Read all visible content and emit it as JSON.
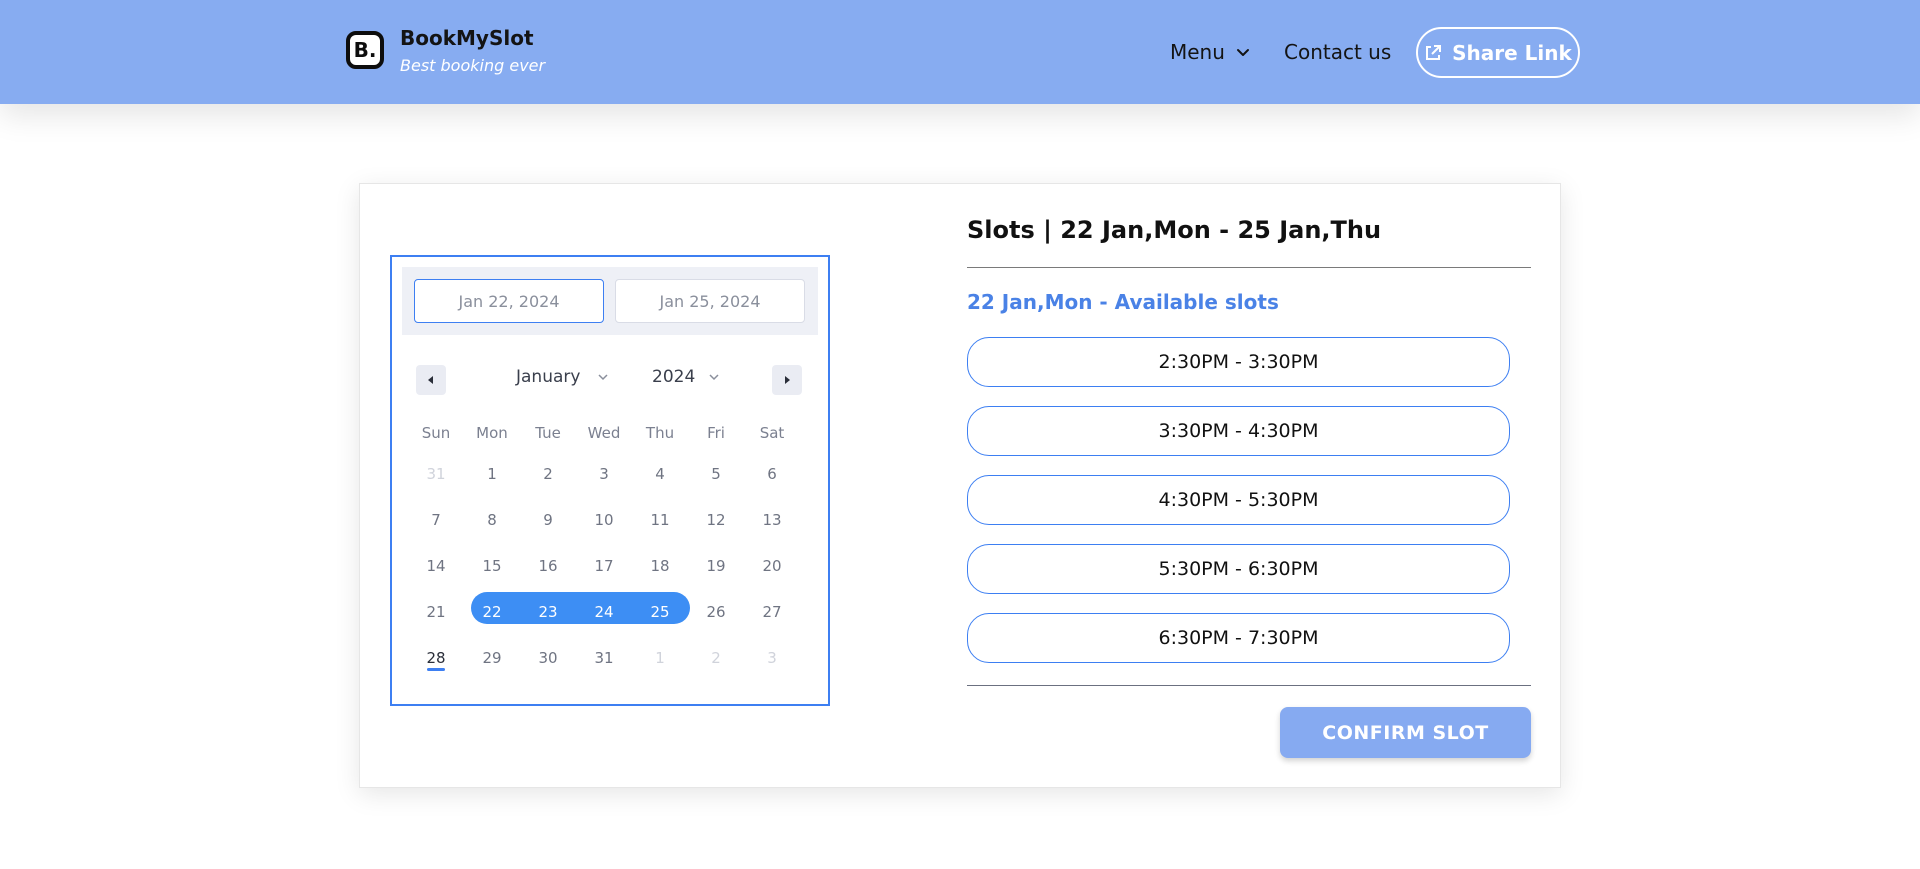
{
  "header": {
    "logo_letter": "B.",
    "brand_name": "BookMySlot",
    "tagline": "Best booking ever",
    "nav": {
      "menu_label": "Menu",
      "contact_label": "Contact us",
      "share_label": "Share Link"
    },
    "colors": {
      "background": "#87acf1"
    }
  },
  "calendar": {
    "start_date": "Jan 22, 2024",
    "end_date": "Jan 25, 2024",
    "month": "January",
    "year": "2024",
    "weekdays": [
      "Sun",
      "Mon",
      "Tue",
      "Wed",
      "Thu",
      "Fri",
      "Sat"
    ],
    "weeks": [
      [
        {
          "d": "31",
          "s": "muted"
        },
        {
          "d": "1"
        },
        {
          "d": "2"
        },
        {
          "d": "3"
        },
        {
          "d": "4"
        },
        {
          "d": "5"
        },
        {
          "d": "6"
        }
      ],
      [
        {
          "d": "7"
        },
        {
          "d": "8"
        },
        {
          "d": "9"
        },
        {
          "d": "10"
        },
        {
          "d": "11"
        },
        {
          "d": "12"
        },
        {
          "d": "13"
        }
      ],
      [
        {
          "d": "14"
        },
        {
          "d": "15"
        },
        {
          "d": "16"
        },
        {
          "d": "17"
        },
        {
          "d": "18"
        },
        {
          "d": "19"
        },
        {
          "d": "20"
        }
      ],
      [
        {
          "d": "21"
        },
        {
          "d": "22",
          "s": "sel"
        },
        {
          "d": "23",
          "s": "sel"
        },
        {
          "d": "24",
          "s": "sel"
        },
        {
          "d": "25",
          "s": "sel"
        },
        {
          "d": "26"
        },
        {
          "d": "27"
        }
      ],
      [
        {
          "d": "28",
          "s": "today"
        },
        {
          "d": "29"
        },
        {
          "d": "30"
        },
        {
          "d": "31"
        },
        {
          "d": "1",
          "s": "muted"
        },
        {
          "d": "2",
          "s": "muted"
        },
        {
          "d": "3",
          "s": "muted"
        }
      ]
    ],
    "colors": {
      "selection": "#3d8ef4",
      "border": "#3d7ff2"
    }
  },
  "slots": {
    "title": "Slots | 22 Jan,Mon - 25 Jan,Thu",
    "subtitle": "22 Jan,Mon - Available slots",
    "items": [
      "2:30PM - 3:30PM",
      "3:30PM - 4:30PM",
      "4:30PM - 5:30PM",
      "5:30PM - 6:30PM",
      "6:30PM - 7:30PM"
    ],
    "confirm_label": "CONFIRM SLOT",
    "colors": {
      "accent": "#4a82e6",
      "button": "#86aaf1"
    }
  }
}
